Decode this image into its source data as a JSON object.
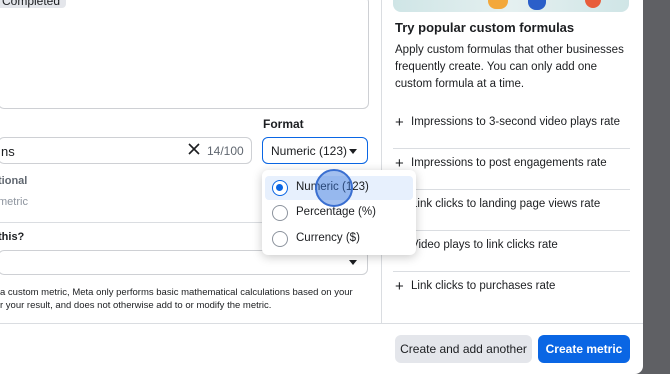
{
  "formula_editor": {
    "badge": "Completed"
  },
  "name_field": {
    "value": "ns",
    "counter": "14/100"
  },
  "format": {
    "label": "Format",
    "selected": "Numeric (123)",
    "options": [
      {
        "label": "Numeric (123)",
        "selected": true
      },
      {
        "label": "Percentage (%)",
        "selected": false
      },
      {
        "label": "Currency ($)",
        "selected": false
      }
    ]
  },
  "description": {
    "label": "tional",
    "placeholder": "metric"
  },
  "question": {
    "label": "this?"
  },
  "disclaimer": {
    "line1": "a custom metric, Meta only performs basic mathematical calculations based on your",
    "line2": "r your result, and does not otherwise add to or modify the metric."
  },
  "panel": {
    "title": "Try popular custom formulas",
    "description": "Apply custom formulas that other businesses frequently create. You can only add one custom formula at a time.",
    "formulas": [
      "Impressions to 3-second video plays rate",
      "Impressions to post engagements rate",
      "Link clicks to landing page views rate",
      "Video plays to link clicks rate",
      "Link clicks to purchases rate"
    ]
  },
  "buttons": {
    "secondary": "Create and add another",
    "primary": "Create metric"
  },
  "colors": {
    "accent": "#0a66e4",
    "selected_bg": "#e7f0fd",
    "backdrop": "#5f6064"
  },
  "icons": {
    "plus": "plus-icon",
    "clear": "close-icon",
    "dropdown": "caret-down-icon"
  }
}
